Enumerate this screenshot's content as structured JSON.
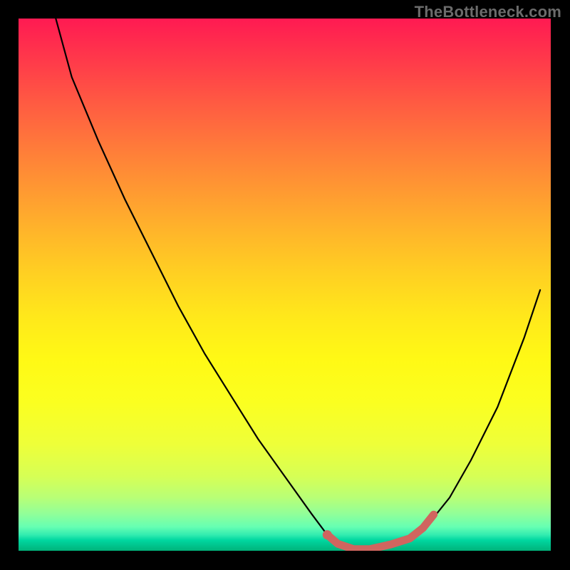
{
  "watermark": "TheBottleneck.com",
  "chart_data": {
    "type": "line",
    "title": "",
    "xlabel": "",
    "ylabel": "",
    "xlim": [
      0,
      100
    ],
    "ylim": [
      0,
      100
    ],
    "grid": false,
    "legend": false,
    "annotations": [],
    "series": [
      {
        "name": "bottleneck-curve",
        "color": "#000000",
        "x": [
          7,
          10,
          15,
          20,
          25,
          30,
          35,
          40,
          45,
          50,
          55,
          58,
          60,
          63,
          66,
          70,
          73,
          77,
          81,
          85,
          90,
          95,
          98
        ],
        "values": [
          100,
          89,
          77,
          66,
          56,
          46,
          37,
          29,
          21,
          14,
          7,
          3,
          1,
          0,
          0,
          1,
          2,
          5,
          10,
          17,
          27,
          40,
          49
        ]
      }
    ],
    "markers": [
      {
        "name": "optimal-range",
        "color": "#d0655f",
        "x": [
          58,
          60,
          63,
          66,
          70,
          73.5,
          76,
          78
        ],
        "values": [
          3,
          1.3,
          0.3,
          0.3,
          1.2,
          2.3,
          4.3,
          6.8
        ]
      }
    ],
    "background_gradient": {
      "direction": "top-to-bottom",
      "stops": [
        {
          "pos": 0,
          "color": "#ff1a52"
        },
        {
          "pos": 35,
          "color": "#ff9832"
        },
        {
          "pos": 60,
          "color": "#ffe81b"
        },
        {
          "pos": 85,
          "color": "#d6ff55"
        },
        {
          "pos": 97,
          "color": "#33ecb0"
        },
        {
          "pos": 100,
          "color": "#00b37a"
        }
      ]
    }
  }
}
